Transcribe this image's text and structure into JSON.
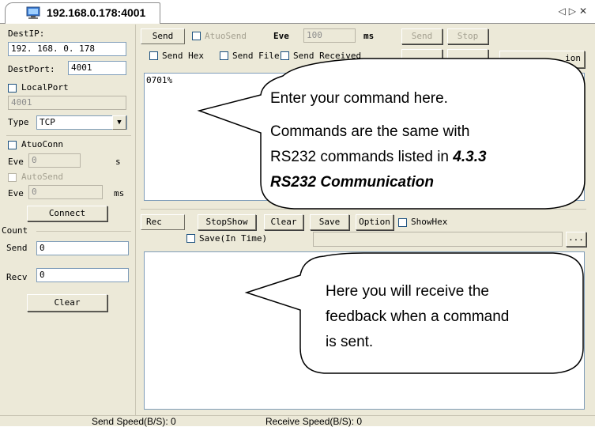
{
  "tab": {
    "title": "192.168.0.178:4001",
    "icon": "network-monitor-icon"
  },
  "tab_controls": {
    "prev": "◁",
    "next": "▷",
    "close": "✕"
  },
  "left": {
    "dest_ip_label": "DestIP:",
    "dest_ip_value": "192. 168. 0. 178",
    "dest_port_label": "DestPort:",
    "dest_port_value": "4001",
    "local_port_label": "LocalPort",
    "local_port_value": "4001",
    "type_label": "Type",
    "type_value": "TCP",
    "auto_conn_label": "AtuoConn",
    "eve1_label": "Eve",
    "eve1_value": "0",
    "eve1_unit": "s",
    "auto_send_label": "AutoSend",
    "eve2_label": "Eve",
    "eve2_value": "0",
    "eve2_unit": "ms",
    "connect_button": "Connect",
    "count_label": "Count",
    "send_label": "Send",
    "send_value": "0",
    "recv_label": "Recv",
    "recv_value": "0",
    "clear_button": "Clear"
  },
  "send_section": {
    "send_tag": "Send",
    "atuo_send_label": "AtuoSend",
    "eve_label": "Eve",
    "eve_value": "100",
    "eve_unit": "ms",
    "send_button": "Send",
    "stop_button": "Stop",
    "send_hex_label": "Send Hex",
    "send_file_label": "Send File",
    "send_received_label": "Send Received",
    "option_button_partial": "ion",
    "command_text": "0701%"
  },
  "rec_section": {
    "rec_tag": "Rec",
    "stopshow_button": "StopShow",
    "clear_button": "Clear",
    "save_button": "Save",
    "option_button": "Option",
    "showhex_label": "ShowHex",
    "save_in_time_label": "Save(In Time)",
    "browse_button": "..."
  },
  "callouts": {
    "send_line1": "Enter your command here.",
    "send_line2": "Commands are the same with",
    "send_line3_prefix": "RS232 commands listed in ",
    "send_line3_bold": "4.3.3",
    "send_line4_bold": "RS232 Communication",
    "recv_line1": "Here you will receive the",
    "recv_line2": "feedback when a command",
    "recv_line3": "is sent."
  },
  "status": {
    "send_speed": "Send Speed(B/S): 0",
    "receive_speed": "Receive Speed(B/S): 0"
  }
}
